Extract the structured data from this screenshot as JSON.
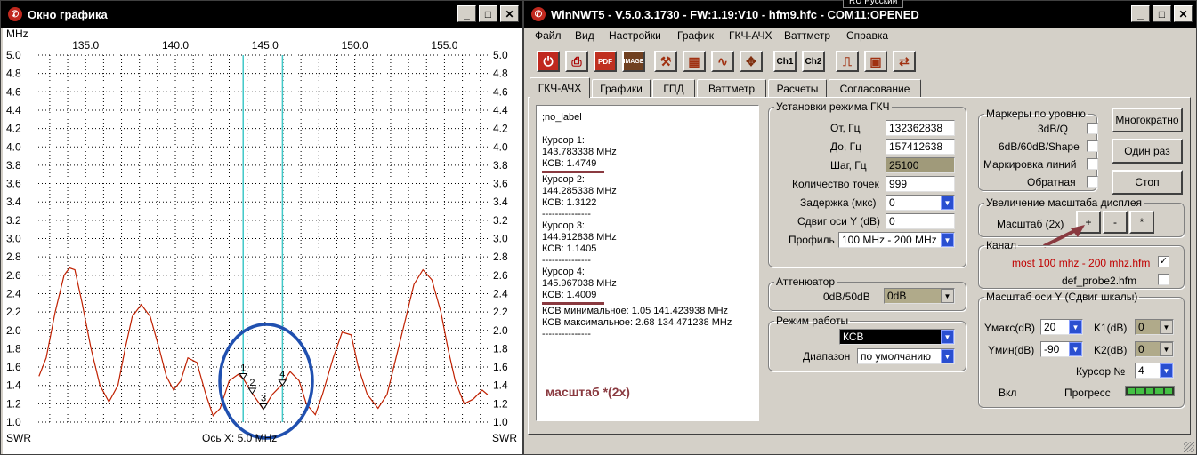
{
  "graph_window": {
    "title": "Окно графика",
    "unit_top_left": "MHz",
    "unit_bottom_left": "SWR",
    "unit_bottom_right": "SWR",
    "axis_x_caption": "Ось X: 5.0 MHz",
    "x_ticks": [
      "135.0",
      "140.0",
      "145.0",
      "150.0",
      "155.0"
    ],
    "y_ticks": [
      "5.0",
      "4.8",
      "4.6",
      "4.4",
      "4.2",
      "4.0",
      "3.8",
      "3.6",
      "3.4",
      "3.2",
      "3.0",
      "2.8",
      "2.6",
      "2.4",
      "2.2",
      "2.0",
      "1.8",
      "1.6",
      "1.4",
      "1.2",
      "1.0"
    ],
    "marker_labels": [
      "1",
      "2",
      "3",
      "4"
    ]
  },
  "chart_data": {
    "type": "line",
    "xlabel": "Ось X: 5.0 MHz",
    "ylabel": "SWR",
    "xlim": [
      132.36,
      157.41
    ],
    "ylim": [
      1.0,
      5.0
    ],
    "grid": true,
    "cursor_lines_mhz": [
      143.78,
      145.97
    ],
    "markers": [
      {
        "label": "1",
        "x": 143.783,
        "y": 1.47
      },
      {
        "label": "2",
        "x": 144.285,
        "y": 1.31
      },
      {
        "label": "3",
        "x": 144.913,
        "y": 1.14
      },
      {
        "label": "4",
        "x": 145.967,
        "y": 1.4
      }
    ],
    "series": [
      {
        "x": [
          132.4,
          132.8,
          133.3,
          133.8,
          134.1,
          134.4,
          134.8,
          135.3,
          135.8,
          136.3,
          136.8,
          137.2,
          137.6,
          138.1,
          138.6,
          139.1,
          139.5,
          139.9,
          140.3,
          140.7,
          141.2,
          141.7,
          142.1,
          142.5,
          143.0,
          143.5,
          143.8,
          144.3,
          144.9,
          145.4,
          145.9,
          146.4,
          146.9,
          147.3,
          147.8,
          148.2,
          148.8,
          149.3,
          149.8,
          150.2,
          150.7,
          151.3,
          151.8,
          152.3,
          152.8,
          153.3,
          153.8,
          154.3,
          154.8,
          155.2,
          155.6,
          156.1,
          156.6,
          157.1,
          157.4
        ],
        "y": [
          1.5,
          1.7,
          2.2,
          2.6,
          2.68,
          2.66,
          2.3,
          1.8,
          1.4,
          1.22,
          1.4,
          1.8,
          2.15,
          2.28,
          2.15,
          1.8,
          1.5,
          1.35,
          1.45,
          1.7,
          1.65,
          1.3,
          1.07,
          1.15,
          1.45,
          1.52,
          1.47,
          1.31,
          1.14,
          1.3,
          1.4,
          1.55,
          1.45,
          1.2,
          1.08,
          1.3,
          1.7,
          1.98,
          1.95,
          1.6,
          1.3,
          1.15,
          1.3,
          1.7,
          2.1,
          2.5,
          2.66,
          2.55,
          2.2,
          1.8,
          1.45,
          1.2,
          1.25,
          1.35,
          1.3
        ]
      }
    ]
  },
  "main_window": {
    "title": "WinNWT5 - V.5.0.3.1730 - FW:1.19:V10 - hfm9.hfc - COM11:OPENED",
    "lang_indicator": "RU Русский",
    "menu": [
      "Файл",
      "Вид",
      "Настройки",
      "График",
      "ГКЧ-АЧХ",
      "Ваттметр",
      "Справка"
    ],
    "toolbar": {
      "pdf_label": "PDF",
      "image_label": "IMAGE",
      "ch1_label": "Ch1",
      "ch2_label": "Ch2"
    },
    "tabs": [
      "ГКЧ-АЧХ",
      "Графики",
      "ГПД",
      "Ваттметр",
      "Расчеты",
      "Согласование"
    ],
    "log": {
      "label": ";no_label",
      "cursor1_title": "Курсор 1:",
      "cursor1_freq": "143.783338 MHz",
      "cursor1_swr": "КСВ: 1.4749",
      "cursor2_title": "Курсор 2:",
      "cursor2_freq": "144.285338 MHz",
      "cursor2_swr": "КСВ: 1.3122",
      "cursor3_title": "Курсор 3:",
      "cursor3_freq": "144.912838 MHz",
      "cursor3_swr": "КСВ: 1.1405",
      "cursor4_title": "Курсор 4:",
      "cursor4_freq": "145.967038 MHz",
      "cursor4_swr": "КСВ: 1.4009",
      "swr_min": "КСВ минимальное: 1.05  141.423938 MHz",
      "swr_max": "КСВ максимальное: 2.68  134.471238 MHz",
      "separator": "---------------",
      "note": "масштаб *(2x)"
    },
    "sweep": {
      "legend": "Установки режима ГКЧ",
      "from_label": "От, Гц",
      "from_value": "132362838",
      "to_label": "До, Гц",
      "to_value": "157412638",
      "step_label": "Шаг, Гц",
      "step_value": "25100",
      "points_label": "Количество точек",
      "points_value": "999",
      "delay_label": "Задержка (мкс)",
      "delay_value": "0",
      "yshift_label": "Сдвиг оси Y (dB)",
      "yshift_value": "0",
      "profile_label": "Профиль",
      "profile_value": "100 MHz - 200 MHz"
    },
    "attenuator": {
      "legend": "Аттенюатор",
      "label": "0dB/50dB",
      "value": "0dB"
    },
    "mode": {
      "legend": "Режим работы",
      "value": "КСВ",
      "range_label": "Диапазон",
      "range_value": "по умолчанию"
    },
    "markers": {
      "legend": "Маркеры по уровню",
      "item1": "3dB/Q",
      "item2": "6dB/60dB/Shape",
      "item3": "Маркировка линий",
      "item4": "Обратная"
    },
    "buttons": {
      "repeat": "Многократно",
      "once": "Один раз",
      "stop": "Стоп"
    },
    "zoom": {
      "legend": "Увеличение масштаба дисплея",
      "label": "Масштаб (2x)",
      "plus": "+",
      "minus": "-",
      "star": "*"
    },
    "channel": {
      "legend": "Канал",
      "file1": "most 100 mhz - 200 mhz.hfm",
      "file2": "def_probe2.hfm"
    },
    "yscale": {
      "legend": "Масштаб оси Y (Сдвиг шкалы)",
      "ymax_label": "Yмакс(dB)",
      "ymax_value": "20",
      "ymin_label": "Yмин(dB)",
      "ymin_value": "-90",
      "k1_label": "K1(dB)",
      "k1_value": "0",
      "k2_label": "K2(dB)",
      "k2_value": "0",
      "cursor_label": "Курсор №",
      "cursor_value": "4",
      "on_label": "Вкл",
      "progress_label": "Прогресс"
    }
  }
}
